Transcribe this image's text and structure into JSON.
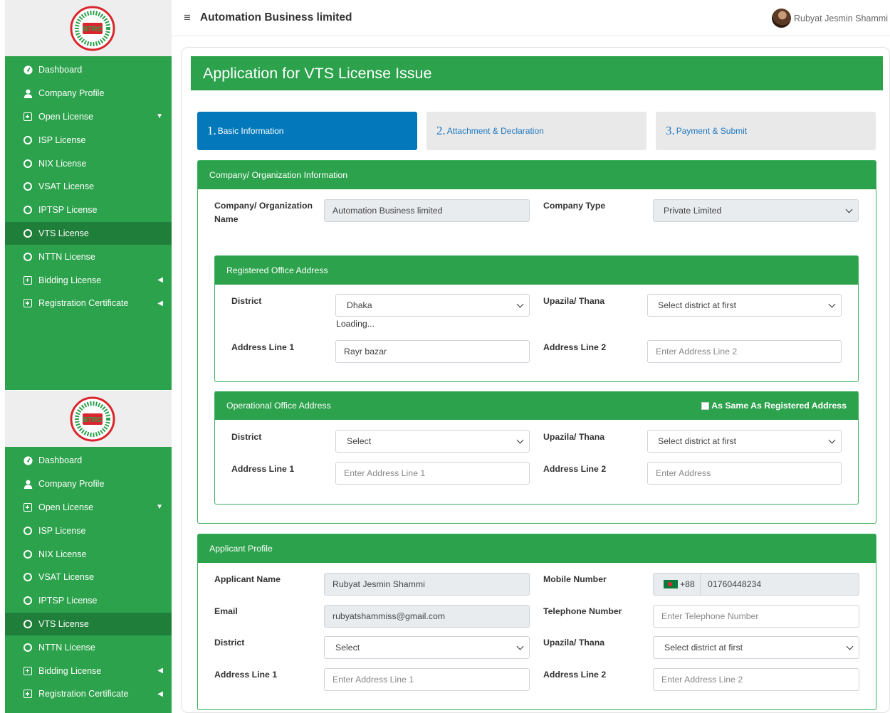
{
  "sidebar": {
    "items": [
      {
        "label": "Dashboard",
        "icon": "dashboard-icon"
      },
      {
        "label": "Company Profile",
        "icon": "user-icon"
      },
      {
        "label": "Open License",
        "icon": "plus-square-icon"
      },
      {
        "label": "ISP License",
        "icon": "circle-icon"
      },
      {
        "label": "NIX License",
        "icon": "circle-icon"
      },
      {
        "label": "VSAT License",
        "icon": "circle-icon"
      },
      {
        "label": "IPTSP License",
        "icon": "circle-icon"
      },
      {
        "label": "VTS License",
        "icon": "circle-icon"
      },
      {
        "label": "NTTN License",
        "icon": "circle-icon"
      },
      {
        "label": "Bidding License",
        "icon": "plus-square-icon"
      },
      {
        "label": "Registration Certificate",
        "icon": "plus-square-icon"
      }
    ],
    "logo_text": "BTRC"
  },
  "topbar": {
    "title": "Automation Business limited",
    "user_name": "Rubyat Jesmin Shammi"
  },
  "page": {
    "title": "Application for VTS License Issue"
  },
  "steps": [
    {
      "num": "1.",
      "label": "Basic Information"
    },
    {
      "num": "2.",
      "label": "Attachment & Declaration"
    },
    {
      "num": "3.",
      "label": "Payment & Submit"
    }
  ],
  "company": {
    "header": "Company/ Organization Information",
    "name_label": "Company/ Organization Name",
    "name_value": "Automation Business limited",
    "type_label": "Company Type",
    "type_value": "Private Limited"
  },
  "registered": {
    "header": "Registered Office Address",
    "district_label": "District",
    "district_value": "Dhaka",
    "loading": "Loading...",
    "upazila_label": "Upazila/ Thana",
    "upazila_value": "Select district at first",
    "addr1_label": "Address Line 1",
    "addr1_value": "Rayr bazar",
    "addr2_label": "Address Line 2",
    "addr2_placeholder": "Enter Address Line 2"
  },
  "operational": {
    "header": "Operational Office Address",
    "same_as": "As Same As Registered Address",
    "district_label": "District",
    "district_value": "Select",
    "upazila_label": "Upazila/ Thana",
    "upazila_value": "Select district at first",
    "addr1_label": "Address Line 1",
    "addr1_placeholder": "Enter Address Line 1",
    "addr2_label": "Address Line 2",
    "addr2_placeholder": "Enter Address"
  },
  "applicant": {
    "header": "Applicant Profile",
    "name_label": "Applicant Name",
    "name_value": "Rubyat Jesmin Shammi",
    "mobile_label": "Mobile Number",
    "mobile_code": "+88",
    "mobile_value": "01760448234",
    "email_label": "Email",
    "email_value": "rubyatshammiss@gmail.com",
    "tel_label": "Telephone Number",
    "tel_placeholder": "Enter Telephone Number",
    "district_label": "District",
    "district_value": "Select",
    "upazila_label": "Upazila/ Thana",
    "upazila_value": "Select district at first",
    "addr1_label": "Address Line 1",
    "addr1_placeholder": "Enter Address Line 1",
    "addr2_label": "Address Line 2",
    "addr2_placeholder": "Enter Address Line 2"
  },
  "colors": {
    "brand_green": "#2ca24c",
    "active_green": "#1f7e39",
    "step_blue": "#0379bb"
  }
}
